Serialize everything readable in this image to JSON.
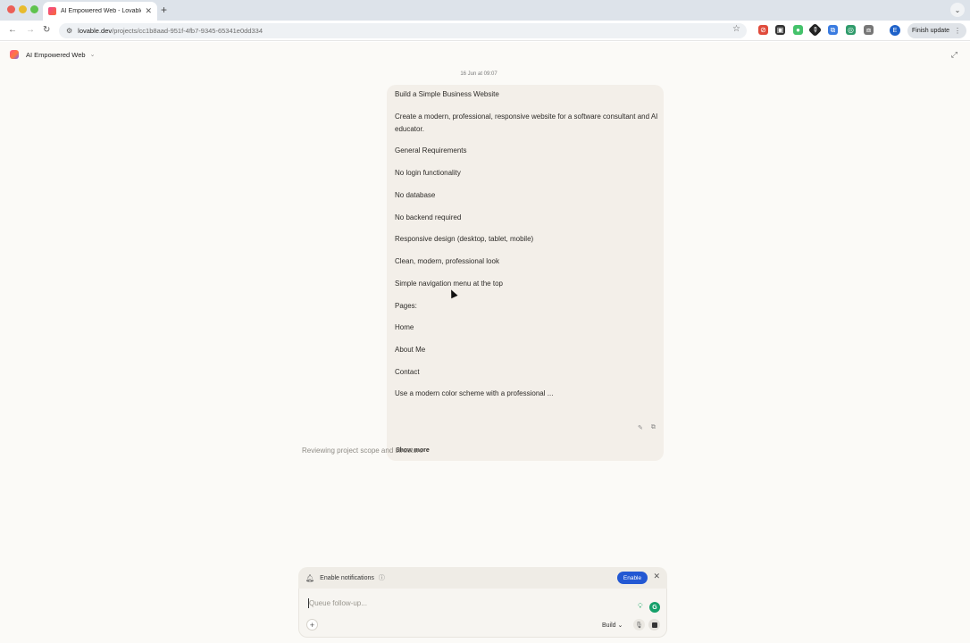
{
  "browser": {
    "tab_title": "AI Empowered Web - Lovable",
    "new_tab": "+",
    "url_host": "lovable.dev",
    "url_path": "/projects/cc1b8aad-951f-4fb7-9345-65341e0dd334",
    "profile_initial": "E",
    "finish_update_label": "Finish update"
  },
  "header": {
    "project_name": "AI Empowered Web"
  },
  "chat": {
    "timestamp": "16 Jun at 09:07",
    "message_lines": [
      "Build a Simple Business Website",
      "Create a modern, professional, responsive website for a software consultant and AI educator.",
      "General Requirements",
      "No login functionality",
      "No database",
      "No backend required",
      "Responsive design (desktop, tablet, mobile)",
      "Clean, modern, professional look",
      "Simple navigation menu at the top",
      "Pages:",
      "Home",
      "About Me",
      "Contact",
      "Use a modern color scheme with a professional ..."
    ],
    "show_more_label": "Show more",
    "status_text": "Reviewing project scope and structure"
  },
  "composer": {
    "notification_text": "Enable notifications",
    "enable_label": "Enable",
    "placeholder": "Queue follow-up...",
    "mode_label": "Build"
  },
  "colors": {
    "accent": "#2358d3",
    "bubble_bg": "#f3efe9",
    "app_bg": "#fbfaf7"
  }
}
